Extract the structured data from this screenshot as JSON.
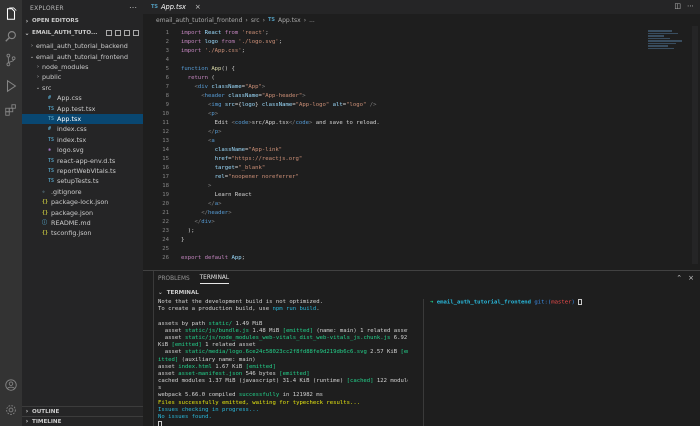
{
  "sidebar": {
    "title": "EXPLORER",
    "open_editors_label": "OPEN EDITORS",
    "project_root": "EMAIL_AUTH_TUTO...",
    "tree": [
      {
        "label": "email_auth_tutorial_backend",
        "depth": 1,
        "chevron": "›",
        "icon": ""
      },
      {
        "label": "email_auth_tutorial_frontend",
        "depth": 1,
        "chevron": "⌄",
        "icon": ""
      },
      {
        "label": "node_modules",
        "depth": 2,
        "chevron": "›",
        "icon": ""
      },
      {
        "label": "public",
        "depth": 2,
        "chevron": "›",
        "icon": ""
      },
      {
        "label": "src",
        "depth": 2,
        "chevron": "⌄",
        "icon": ""
      },
      {
        "label": "App.css",
        "depth": 3,
        "chevron": "",
        "icon": "#"
      },
      {
        "label": "App.test.tsx",
        "depth": 3,
        "chevron": "",
        "icon": "TS"
      },
      {
        "label": "App.tsx",
        "depth": 3,
        "chevron": "",
        "icon": "TS",
        "active": true
      },
      {
        "label": "index.css",
        "depth": 3,
        "chevron": "",
        "icon": "#"
      },
      {
        "label": "index.tsx",
        "depth": 3,
        "chevron": "",
        "icon": "TS"
      },
      {
        "label": "logo.svg",
        "depth": 3,
        "chevron": "",
        "icon": "✱"
      },
      {
        "label": "react-app-env.d.ts",
        "depth": 3,
        "chevron": "",
        "icon": "TS"
      },
      {
        "label": "reportWebVitals.ts",
        "depth": 3,
        "chevron": "",
        "icon": "TS"
      },
      {
        "label": "setupTests.ts",
        "depth": 3,
        "chevron": "",
        "icon": "TS"
      },
      {
        "label": ".gitignore",
        "depth": 2,
        "chevron": "",
        "icon": "◆"
      },
      {
        "label": "package-lock.json",
        "depth": 2,
        "chevron": "",
        "icon": "{}"
      },
      {
        "label": "package.json",
        "depth": 2,
        "chevron": "",
        "icon": "{}"
      },
      {
        "label": "README.md",
        "depth": 2,
        "chevron": "",
        "icon": "ⓘ"
      },
      {
        "label": "tsconfig.json",
        "depth": 2,
        "chevron": "",
        "icon": "{}"
      }
    ],
    "outline_label": "OUTLINE",
    "timeline_label": "TIMELINE"
  },
  "editor": {
    "tab": {
      "icon": "TS",
      "label": "App.tsx"
    },
    "breadcrumb": [
      "email_auth_tutorial_frontend",
      "src",
      "TS",
      "App.tsx",
      "..."
    ],
    "code_lines": [
      [
        [
          "kw",
          "import "
        ],
        [
          "var",
          "React "
        ],
        [
          "kw",
          "from "
        ],
        [
          "str",
          "'react'"
        ],
        [
          "plain",
          ";"
        ]
      ],
      [
        [
          "kw",
          "import "
        ],
        [
          "var",
          "logo "
        ],
        [
          "kw",
          "from "
        ],
        [
          "str",
          "'./logo.svg'"
        ],
        [
          "plain",
          ";"
        ]
      ],
      [
        [
          "kw",
          "import "
        ],
        [
          "str",
          "'./App.css'"
        ],
        [
          "plain",
          ";"
        ]
      ],
      [],
      [
        [
          "kw2",
          "function "
        ],
        [
          "fn",
          "App"
        ],
        [
          "plain",
          "() {"
        ]
      ],
      [
        [
          "plain",
          "  "
        ],
        [
          "kw",
          "return "
        ],
        [
          "plain",
          "("
        ]
      ],
      [
        [
          "plain",
          "    "
        ],
        [
          "jsx",
          "<"
        ],
        [
          "tag",
          "div "
        ],
        [
          "attr",
          "className"
        ],
        [
          "plain",
          "="
        ],
        [
          "str",
          "\"App\""
        ],
        [
          "jsx",
          ">"
        ]
      ],
      [
        [
          "plain",
          "      "
        ],
        [
          "jsx",
          "<"
        ],
        [
          "tag",
          "header "
        ],
        [
          "attr",
          "className"
        ],
        [
          "plain",
          "="
        ],
        [
          "str",
          "\"App-header\""
        ],
        [
          "jsx",
          ">"
        ]
      ],
      [
        [
          "plain",
          "        "
        ],
        [
          "jsx",
          "<"
        ],
        [
          "tag",
          "img "
        ],
        [
          "attr",
          "src"
        ],
        [
          "plain",
          "={"
        ],
        [
          "var",
          "logo"
        ],
        [
          "plain",
          "} "
        ],
        [
          "attr",
          "className"
        ],
        [
          "plain",
          "="
        ],
        [
          "str",
          "\"App-logo\" "
        ],
        [
          "attr",
          "alt"
        ],
        [
          "plain",
          "="
        ],
        [
          "str",
          "\"logo\" "
        ],
        [
          "jsx",
          "/>"
        ]
      ],
      [
        [
          "plain",
          "        "
        ],
        [
          "jsx",
          "<"
        ],
        [
          "tag",
          "p"
        ],
        [
          "jsx",
          ">"
        ]
      ],
      [
        [
          "plain",
          "          Edit "
        ],
        [
          "jsx",
          "<"
        ],
        [
          "tag",
          "code"
        ],
        [
          "jsx",
          ">"
        ],
        [
          "plain",
          "src/App.tsx"
        ],
        [
          "jsx",
          "</"
        ],
        [
          "tag",
          "code"
        ],
        [
          "jsx",
          ">"
        ],
        [
          "plain",
          " and save to reload."
        ]
      ],
      [
        [
          "plain",
          "        "
        ],
        [
          "jsx",
          "</"
        ],
        [
          "tag",
          "p"
        ],
        [
          "jsx",
          ">"
        ]
      ],
      [
        [
          "plain",
          "        "
        ],
        [
          "jsx",
          "<"
        ],
        [
          "tag",
          "a"
        ]
      ],
      [
        [
          "plain",
          "          "
        ],
        [
          "attr",
          "className"
        ],
        [
          "plain",
          "="
        ],
        [
          "str",
          "\"App-link\""
        ]
      ],
      [
        [
          "plain",
          "          "
        ],
        [
          "attr",
          "href"
        ],
        [
          "plain",
          "="
        ],
        [
          "str",
          "\"https://reactjs.org\""
        ]
      ],
      [
        [
          "plain",
          "          "
        ],
        [
          "attr",
          "target"
        ],
        [
          "plain",
          "="
        ],
        [
          "str",
          "\"_blank\""
        ]
      ],
      [
        [
          "plain",
          "          "
        ],
        [
          "attr",
          "rel"
        ],
        [
          "plain",
          "="
        ],
        [
          "str",
          "\"noopener noreferrer\""
        ]
      ],
      [
        [
          "plain",
          "        "
        ],
        [
          "jsx",
          ">"
        ]
      ],
      [
        [
          "plain",
          "          Learn React"
        ]
      ],
      [
        [
          "plain",
          "        "
        ],
        [
          "jsx",
          "</"
        ],
        [
          "tag",
          "a"
        ],
        [
          "jsx",
          ">"
        ]
      ],
      [
        [
          "plain",
          "      "
        ],
        [
          "jsx",
          "</"
        ],
        [
          "tag",
          "header"
        ],
        [
          "jsx",
          ">"
        ]
      ],
      [
        [
          "plain",
          "    "
        ],
        [
          "jsx",
          "</"
        ],
        [
          "tag",
          "div"
        ],
        [
          "jsx",
          ">"
        ]
      ],
      [
        [
          "plain",
          "  );"
        ]
      ],
      [
        [
          "plain",
          "}"
        ]
      ],
      [],
      [
        [
          "kw",
          "export "
        ],
        [
          "kw",
          "default "
        ],
        [
          "var",
          "App"
        ],
        [
          "plain",
          ";"
        ]
      ],
      []
    ]
  },
  "panel": {
    "tabs": [
      {
        "label": "PROBLEMS",
        "active": false
      },
      {
        "label": "TERMINAL",
        "active": true
      }
    ],
    "section_label": "TERMINAL",
    "terminal_lines": [
      [
        [
          "white",
          "Note that the development build is not optimized."
        ]
      ],
      [
        [
          "white",
          "To create a production build, use "
        ],
        [
          "cyan",
          "npm run build"
        ],
        [
          "white",
          "."
        ]
      ],
      [],
      [
        [
          "white",
          "assets by path "
        ],
        [
          "green",
          "static/"
        ],
        [
          "white",
          " 1.49 MiB"
        ]
      ],
      [
        [
          "white",
          "  asset "
        ],
        [
          "green",
          "static/js/bundle.js"
        ],
        [
          "white",
          " 1.48 MiB "
        ],
        [
          "green",
          "[emitted]"
        ],
        [
          "white",
          " (name: main) 1 related asset"
        ]
      ],
      [
        [
          "white",
          "  asset "
        ],
        [
          "green",
          "static/js/node_modules_web-vitals_dist_web-vitals_js.chunk.js"
        ],
        [
          "white",
          " 6.92"
        ]
      ],
      [
        [
          "white",
          "KiB "
        ],
        [
          "green",
          "[emitted]"
        ],
        [
          "white",
          " 1 related asset"
        ]
      ],
      [
        [
          "white",
          "  asset "
        ],
        [
          "green",
          "static/media/logo.6ce24c58023cc2f8fd88fe9d219db6c6.svg"
        ],
        [
          "white",
          " 2.57 KiB "
        ],
        [
          "green",
          "[em"
        ]
      ],
      [
        [
          "green",
          "itted]"
        ],
        [
          "white",
          " (auxiliary name: main)"
        ]
      ],
      [
        [
          "white",
          "asset "
        ],
        [
          "green",
          "index.html"
        ],
        [
          "white",
          " 1.67 KiB "
        ],
        [
          "green",
          "[emitted]"
        ]
      ],
      [
        [
          "white",
          "asset "
        ],
        [
          "green",
          "asset-manifest.json"
        ],
        [
          "white",
          " 546 bytes "
        ],
        [
          "green",
          "[emitted]"
        ]
      ],
      [
        [
          "white",
          "cached modules 1.37 MiB (javascript) 31.4 KiB (runtime) "
        ],
        [
          "green",
          "[cached]"
        ],
        [
          "white",
          " 122 module"
        ]
      ],
      [
        [
          "white",
          "s"
        ]
      ],
      [
        [
          "white",
          "webpack 5.66.0 compiled "
        ],
        [
          "green",
          "successfully"
        ],
        [
          "white",
          " in 121982 ms"
        ]
      ],
      [
        [
          "yellow",
          "Files successfully emitted, waiting for typecheck results..."
        ]
      ],
      [
        [
          "cyan",
          "Issues checking in progress..."
        ]
      ],
      [
        [
          "cyan",
          "No issues found."
        ]
      ]
    ],
    "right_prompt": {
      "arrow": "➜",
      "dir": "email_auth_tutorial_frontend",
      "git": "git:(",
      "branch": "master",
      "git_close": ")"
    }
  }
}
